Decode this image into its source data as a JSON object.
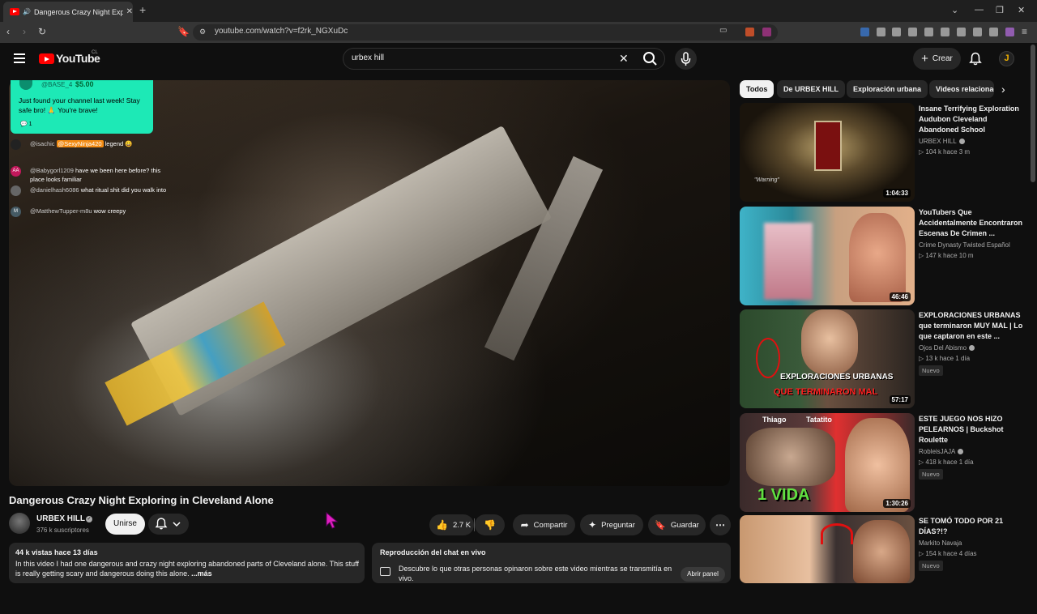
{
  "browser": {
    "tab_title": "Dangerous Crazy Night Explo",
    "url": "youtube.com/watch?v=f2rk_NGXuDc"
  },
  "header": {
    "logo_text": "YouTube",
    "country_code": "CL",
    "search_value": "urbex hill",
    "create_label": "Crear",
    "avatar_initial": "J"
  },
  "chat": {
    "donation": {
      "name": "@BASE_4",
      "amount": "$5.00",
      "message": "Just found your channel last week! Stay safe bro! 🙏 You're brave!",
      "count": "1"
    },
    "messages": [
      {
        "user": "@isachic",
        "badge": "@SexyNinja420",
        "text": "legend 😀",
        "avatar": ""
      },
      {
        "user": "@Babygorl1209",
        "text": "have we been here before? this place looks familiar",
        "avatar": "AA"
      },
      {
        "user": "@danielhash6086",
        "text": "what ritual shit did you walk into",
        "avatar": ""
      },
      {
        "user": "@MatthewTupper-m8u",
        "text": "wow creepy",
        "avatar": "M"
      }
    ]
  },
  "video": {
    "title": "Dangerous Crazy Night Exploring in Cleveland Alone",
    "channel": "URBEX HILL",
    "subscribers": "376 k suscriptores",
    "join_label": "Unirse",
    "likes": "2.7 K",
    "share_label": "Compartir",
    "ask_label": "Preguntar",
    "save_label": "Guardar"
  },
  "description": {
    "meta": "44 k vistas  hace 13 días",
    "text": "In this video I had one dangerous and crazy night exploring abandoned parts of Cleveland alone. This stuff is really getting scary and dangerous doing this alone.",
    "more": "...más"
  },
  "chat_replay": {
    "title": "Reproducción del chat en vivo",
    "text": "Descubre lo que otras personas opinaron sobre este video mientras se transmitía en vivo.",
    "button": "Abrir panel"
  },
  "chips": [
    "Todos",
    "De URBEX HILL",
    "Exploración urbana",
    "Videos relacionados"
  ],
  "recommendations": [
    {
      "title": "Insane Terrifying Exploration Audubon Cleveland Abandoned School",
      "channel": "URBEX HILL",
      "verified": true,
      "meta": "104 k  hace 3 m",
      "duration": "1:04:33",
      "badge": ""
    },
    {
      "title": "YouTubers Que Accidentalmente Encontraron Escenas De Crimen ...",
      "channel": "Crime Dynasty Twisted Español",
      "verified": false,
      "meta": "147 k  hace 10 m",
      "duration": "46:46",
      "badge": ""
    },
    {
      "title": "EXPLORACIONES URBANAS que terminaron MUY MAL | Lo que captaron en este ...",
      "channel": "Ojos Del Abismo",
      "verified": true,
      "meta": "13 k  hace 1 día",
      "duration": "57:17",
      "badge": "Nuevo"
    },
    {
      "title": "ESTE JUEGO NOS HIZO PELEARNOS | Buckshot Roulette",
      "channel": "RobleisJAJA",
      "verified": true,
      "meta": "418 k  hace 1 día",
      "duration": "1:30:26",
      "badge": "Nuevo"
    },
    {
      "title": "SE TOMÓ TODO POR 21 DÍAS?!?",
      "channel": "Markito Navaja",
      "verified": false,
      "meta": "154 k  hace 4 días",
      "duration": "",
      "badge": "Nuevo"
    }
  ],
  "thumb_text": {
    "t1_warning": "\"Warning\"",
    "t3_overlay_1": "EXPLORACIONES URBANAS",
    "t3_overlay_2": "QUE TERMINARON MAL",
    "t4_name1": "Thiago",
    "t4_name2": "Tatatito",
    "t4_big": "1 VIDA"
  }
}
